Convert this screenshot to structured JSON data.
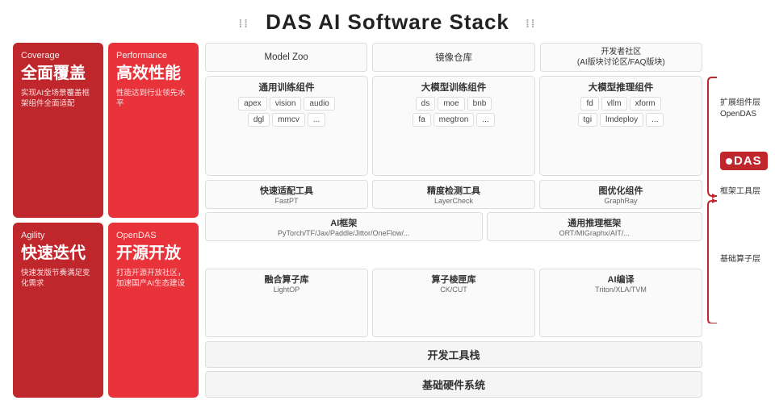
{
  "header": {
    "title": "DAS AI Software Stack",
    "dots_left": "⁞⁞",
    "dots_right": "⁞⁞"
  },
  "left_cards": {
    "top_left": {
      "subtitle": "Coverage",
      "title_zh": "全面覆盖",
      "desc": "实现AI全场景覆盖框架组件全面适配"
    },
    "top_right": {
      "subtitle": "Performance",
      "title_zh": "高效性能",
      "desc": "性能达到行业领先水平"
    },
    "bottom_left": {
      "subtitle": "Agility",
      "title_zh": "快速迭代",
      "desc": "快速发版节奏满足变化需求"
    },
    "bottom_right": {
      "subtitle": "OpenDAS",
      "title_zh": "开源开放",
      "desc": "打造开源开放社区，加速国产AI生态建设"
    }
  },
  "top_bar": [
    {
      "label": "Model Zoo"
    },
    {
      "label": "镜像仓库"
    },
    {
      "label": "开发者社区\n(AI版块讨论区/FAQ版块)"
    }
  ],
  "components_layer": {
    "groups": [
      {
        "title": "通用训练组件",
        "tags_row1": [
          "apex",
          "vision",
          "audio"
        ],
        "tags_row2": [
          "dgl",
          "mmcv",
          "..."
        ]
      },
      {
        "title": "大模型训练组件",
        "tags_row1": [
          "ds",
          "moe",
          "bnb"
        ],
        "tags_row2": [
          "fa",
          "megtron",
          "..."
        ]
      },
      {
        "title": "大模型推理组件",
        "tags_row1": [
          "fd",
          "vllm",
          "xform"
        ],
        "tags_row2": [
          "tgi",
          "lmdeploy",
          "..."
        ]
      }
    ],
    "layer_label": "扩展组件层\nOpenDAS"
  },
  "framework_layer": {
    "row1": [
      {
        "main": "快速适配工具",
        "sub": "FastPT"
      },
      {
        "main": "精度检测工具",
        "sub": "LayerCheck"
      },
      {
        "main": "图优化组件",
        "sub": "GraphRay"
      }
    ],
    "row2": [
      {
        "main": "AI框架",
        "sub": "PyTorch/TF/Jax/Paddle/Jittor/OneFlow/..."
      },
      {
        "main": "通用推理框架",
        "sub": "ORT/MIGraphx/AIT/..."
      }
    ],
    "layer_label": "框架工具层"
  },
  "compute_layer": {
    "items": [
      {
        "main": "融合算子库",
        "sub": "LightOP"
      },
      {
        "main": "算子棱匣库",
        "sub": "CK/CUT"
      },
      {
        "main": "AI编译",
        "sub": "Triton/XLA/TVM"
      }
    ],
    "layer_label": "基础算子层"
  },
  "bottom_bars": [
    {
      "label": "开发工具栈"
    },
    {
      "label": "基础硬件系统"
    }
  ],
  "das_logo": {
    "text": "DAS",
    "dot_label": "·"
  }
}
